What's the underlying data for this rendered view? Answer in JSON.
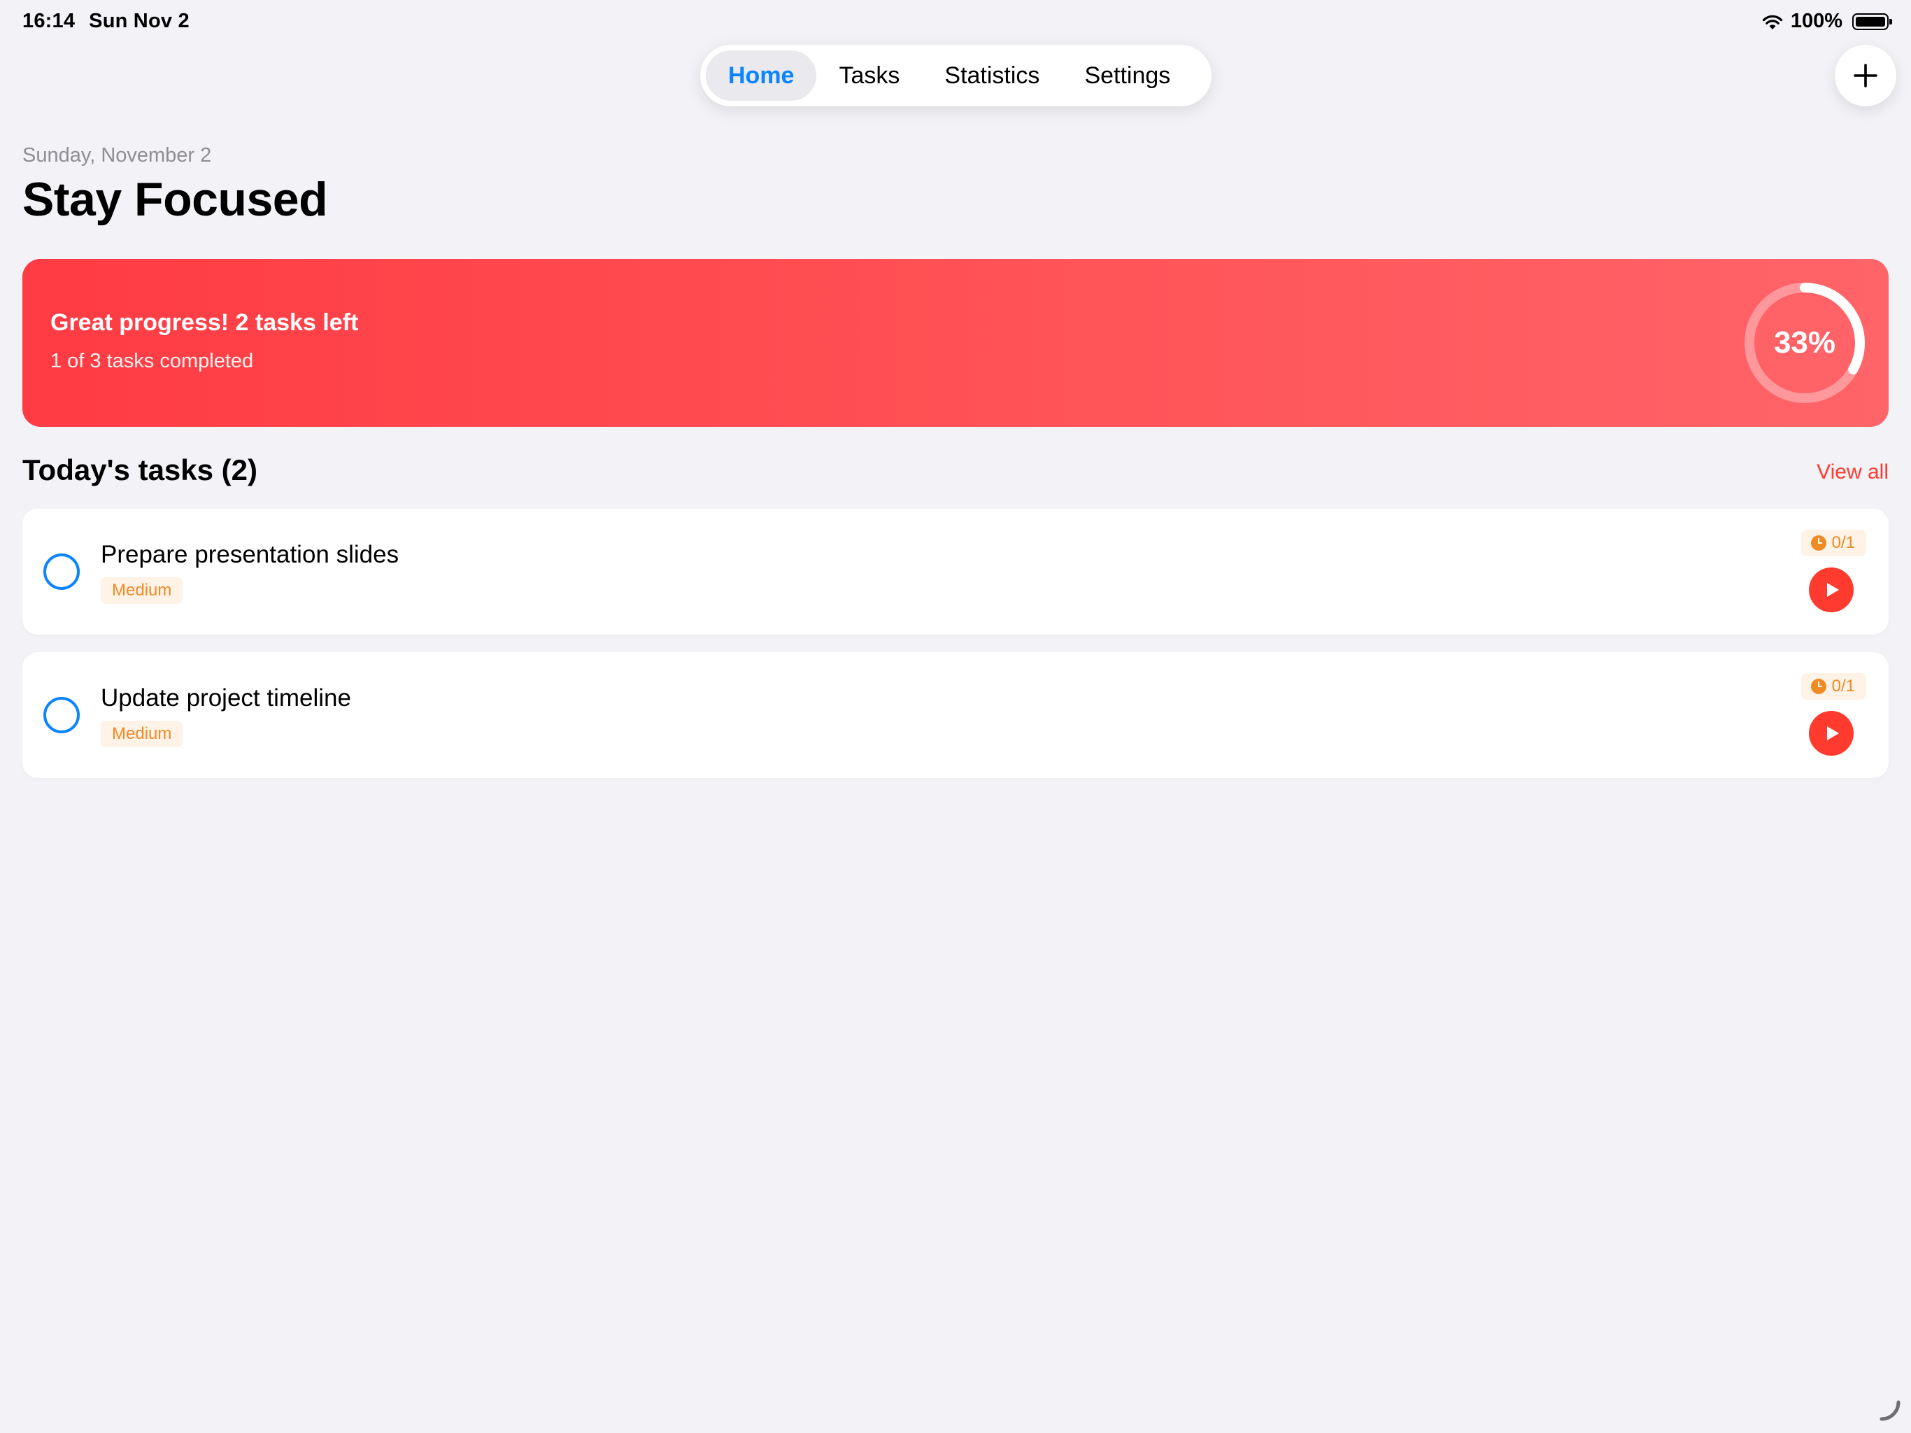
{
  "status_bar": {
    "time": "16:14",
    "date": "Sun Nov 2",
    "battery": "100%"
  },
  "nav": {
    "tabs": [
      {
        "label": "Home",
        "active": true
      },
      {
        "label": "Tasks",
        "active": false
      },
      {
        "label": "Statistics",
        "active": false
      },
      {
        "label": "Settings",
        "active": false
      }
    ]
  },
  "add_button": {
    "icon": "plus-icon"
  },
  "header": {
    "date": "Sunday, November 2",
    "title": "Stay Focused"
  },
  "progress": {
    "headline": "Great progress! 2 tasks left",
    "subtext": "1 of 3 tasks completed",
    "percent_label": "33%",
    "fraction": 0.33
  },
  "tasks_section": {
    "title": "Today's tasks (2)",
    "view_all": "View all"
  },
  "tasks": [
    {
      "title": "Prepare presentation slides",
      "priority": "Medium",
      "pomodoros": "0/1"
    },
    {
      "title": "Update project timeline",
      "priority": "Medium",
      "pomodoros": "0/1"
    }
  ],
  "colors": {
    "accent_blue": "#0a84ff",
    "accent_red": "#ff3b30",
    "priority_orange": "#f08a24",
    "background": "#f2f2f7"
  }
}
